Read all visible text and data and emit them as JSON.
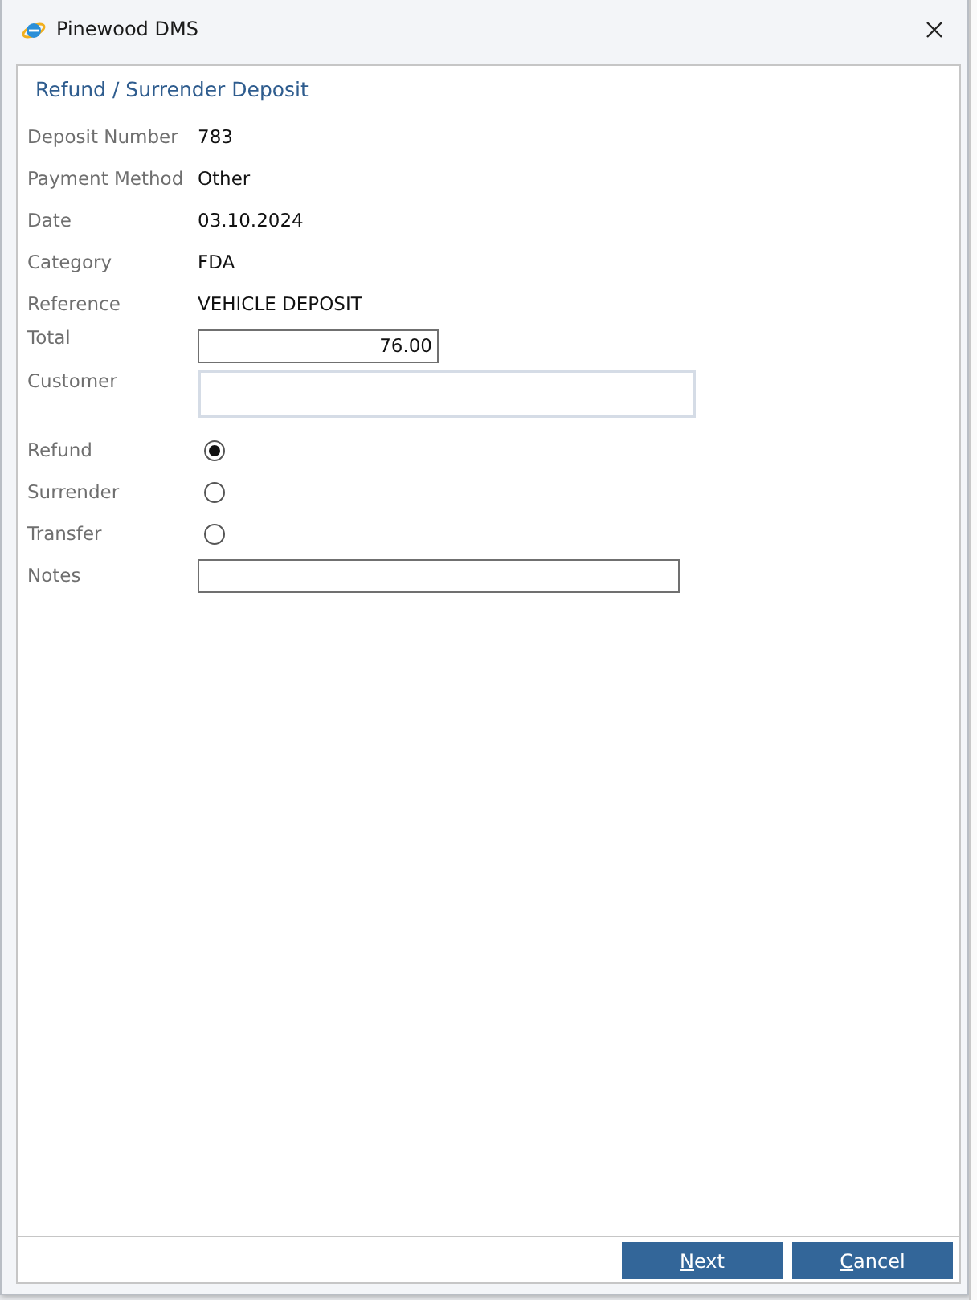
{
  "window": {
    "title": "Pinewood DMS"
  },
  "heading": "Refund / Surrender Deposit",
  "fields": [
    {
      "kind": "text",
      "label": "Deposit Number",
      "value": "783"
    },
    {
      "kind": "text",
      "label": "Payment Method",
      "value": "Other"
    },
    {
      "kind": "text",
      "label": "Date",
      "value": "03.10.2024"
    },
    {
      "kind": "text",
      "label": "Category",
      "value": "FDA"
    },
    {
      "kind": "text",
      "label": "Reference",
      "value": "VEHICLE DEPOSIT"
    },
    {
      "kind": "amount",
      "label": "Total",
      "value": "76.00"
    },
    {
      "kind": "lookup",
      "label": "Customer"
    },
    {
      "kind": "radio",
      "label": "Refund",
      "selected": true
    },
    {
      "kind": "radio",
      "label": "Surrender",
      "selected": false
    },
    {
      "kind": "radio",
      "label": "Transfer",
      "selected": false
    },
    {
      "kind": "input",
      "label": "Notes"
    }
  ],
  "buttons": [
    {
      "label": "Next",
      "first_letter_underlined": true
    },
    {
      "label": "Cancel",
      "first_letter_underlined": true
    }
  ]
}
